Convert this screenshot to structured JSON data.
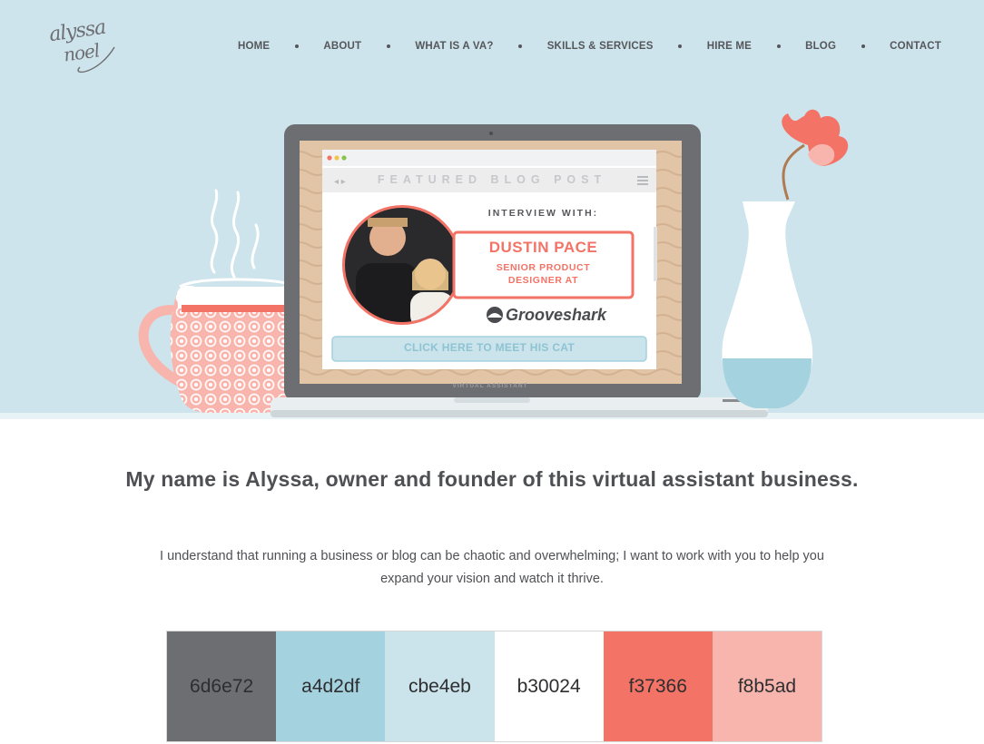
{
  "logo": {
    "line1": "alyssa",
    "line2": "noel"
  },
  "nav": {
    "items": [
      {
        "label": "HOME"
      },
      {
        "label": "ABOUT"
      },
      {
        "label": "WHAT IS A VA?"
      },
      {
        "label": "SKILLS & SERVICES"
      },
      {
        "label": "HIRE ME"
      },
      {
        "label": "BLOG"
      },
      {
        "label": "CONTACT"
      }
    ]
  },
  "feature": {
    "bar_title": "FEATURED BLOG POST",
    "interview_with": "INTERVIEW WITH:",
    "name": "DUSTIN PACE",
    "role_line1": "SENIOR PRODUCT",
    "role_line2": "DESIGNER AT",
    "company": "Grooveshark",
    "cta": "CLICK HERE TO MEET HIS CAT",
    "laptop_caption": "VIRTUAL ASSISTANT"
  },
  "main": {
    "headline": "My name is Alyssa, owner and founder of this virtual assistant business.",
    "intro_line1": "I understand that running a business or blog can be chaotic and overwhelming; I want to work with you to help you",
    "intro_line2": "expand your vision and watch it thrive."
  },
  "palette": [
    {
      "label": "6d6e72",
      "color": "#6d6e72"
    },
    {
      "label": "a4d2df",
      "color": "#a4d2df"
    },
    {
      "label": "cbe4eb",
      "color": "#cbe4eb"
    },
    {
      "label": "b30024",
      "color": "#ffffff"
    },
    {
      "label": "f37366",
      "color": "#f37366"
    },
    {
      "label": "f8b5ad",
      "color": "#f8b5ad"
    }
  ],
  "colors": {
    "hero_bg": "#cde4ec",
    "accent_coral": "#f37366",
    "accent_pink": "#f8b5ad",
    "light_blue": "#a4d2df",
    "gray": "#6d6e72"
  }
}
